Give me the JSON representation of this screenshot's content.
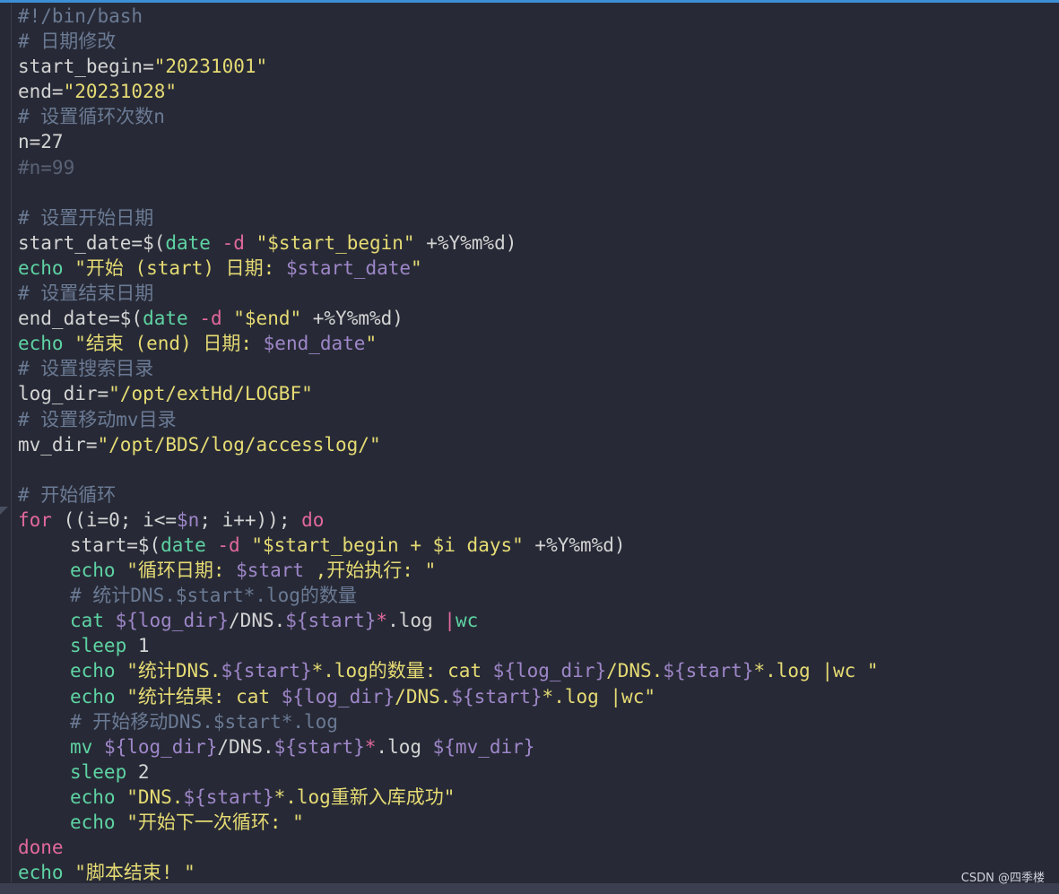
{
  "editor": {
    "lines": [
      {
        "indent": false,
        "tokens": [
          {
            "t": "#!/bin/bash",
            "c": "c-comment"
          }
        ]
      },
      {
        "indent": false,
        "tokens": [
          {
            "t": "# 日期修改",
            "c": "c-comment"
          }
        ]
      },
      {
        "indent": false,
        "tokens": [
          {
            "t": "start_begin=",
            "c": "c-var"
          },
          {
            "t": "\"20231001\"",
            "c": "c-str"
          }
        ]
      },
      {
        "indent": false,
        "tokens": [
          {
            "t": "end=",
            "c": "c-var"
          },
          {
            "t": "\"20231028\"",
            "c": "c-str"
          }
        ]
      },
      {
        "indent": false,
        "tokens": [
          {
            "t": "# 设置循环次数n",
            "c": "c-comment"
          }
        ]
      },
      {
        "indent": false,
        "tokens": [
          {
            "t": "n=27",
            "c": "c-var"
          }
        ]
      },
      {
        "indent": false,
        "tokens": [
          {
            "t": "#n=99",
            "c": "c-comment-dim"
          }
        ]
      },
      {
        "indent": false,
        "tokens": [
          {
            "t": "",
            "c": "c-var"
          }
        ]
      },
      {
        "indent": false,
        "tokens": [
          {
            "t": "# 设置开始日期",
            "c": "c-comment"
          }
        ]
      },
      {
        "indent": false,
        "tokens": [
          {
            "t": "start_date=$(",
            "c": "c-var"
          },
          {
            "t": "date",
            "c": "c-cmd"
          },
          {
            "t": " ",
            "c": "c-var"
          },
          {
            "t": "-d",
            "c": "c-flag"
          },
          {
            "t": " ",
            "c": "c-var"
          },
          {
            "t": "\"$start_begin\"",
            "c": "c-str"
          },
          {
            "t": " +%Y%m%d)",
            "c": "c-var"
          }
        ]
      },
      {
        "indent": false,
        "tokens": [
          {
            "t": "echo",
            "c": "c-cmd"
          },
          {
            "t": " \"开始 (start) 日期: ",
            "c": "c-str"
          },
          {
            "t": "$start_date",
            "c": "c-sub"
          },
          {
            "t": "\"",
            "c": "c-str"
          }
        ]
      },
      {
        "indent": false,
        "tokens": [
          {
            "t": "# 设置结束日期",
            "c": "c-comment"
          }
        ]
      },
      {
        "indent": false,
        "tokens": [
          {
            "t": "end_date=$(",
            "c": "c-var"
          },
          {
            "t": "date",
            "c": "c-cmd"
          },
          {
            "t": " ",
            "c": "c-var"
          },
          {
            "t": "-d",
            "c": "c-flag"
          },
          {
            "t": " ",
            "c": "c-var"
          },
          {
            "t": "\"$end\"",
            "c": "c-str"
          },
          {
            "t": " +%Y%m%d)",
            "c": "c-var"
          }
        ]
      },
      {
        "indent": false,
        "tokens": [
          {
            "t": "echo",
            "c": "c-cmd"
          },
          {
            "t": " \"结束 (end) 日期: ",
            "c": "c-str"
          },
          {
            "t": "$end_date",
            "c": "c-sub"
          },
          {
            "t": "\"",
            "c": "c-str"
          }
        ]
      },
      {
        "indent": false,
        "tokens": [
          {
            "t": "# 设置搜索目录",
            "c": "c-comment"
          }
        ]
      },
      {
        "indent": false,
        "tokens": [
          {
            "t": "log_dir=",
            "c": "c-var"
          },
          {
            "t": "\"/opt/extHd/LOGBF\"",
            "c": "c-str"
          }
        ]
      },
      {
        "indent": false,
        "tokens": [
          {
            "t": "# 设置移动mv目录",
            "c": "c-comment"
          }
        ]
      },
      {
        "indent": false,
        "tokens": [
          {
            "t": "mv_dir=",
            "c": "c-var"
          },
          {
            "t": "\"/opt/BDS/log/accesslog/\"",
            "c": "c-str"
          }
        ]
      },
      {
        "indent": false,
        "tokens": [
          {
            "t": "",
            "c": "c-var"
          }
        ]
      },
      {
        "indent": false,
        "tokens": [
          {
            "t": "# 开始循环",
            "c": "c-comment"
          }
        ]
      },
      {
        "indent": false,
        "tokens": [
          {
            "t": "for",
            "c": "c-kw"
          },
          {
            "t": " ((i=0; i<=",
            "c": "c-var"
          },
          {
            "t": "$n",
            "c": "c-sub"
          },
          {
            "t": "; i++)); ",
            "c": "c-var"
          },
          {
            "t": "do",
            "c": "c-kw"
          }
        ]
      },
      {
        "indent": true,
        "tokens": [
          {
            "t": "start=$(",
            "c": "c-var"
          },
          {
            "t": "date",
            "c": "c-cmd"
          },
          {
            "t": " ",
            "c": "c-var"
          },
          {
            "t": "-d",
            "c": "c-flag"
          },
          {
            "t": " ",
            "c": "c-var"
          },
          {
            "t": "\"$start_begin + $i days\"",
            "c": "c-str"
          },
          {
            "t": " +%Y%m%d)",
            "c": "c-var"
          }
        ]
      },
      {
        "indent": true,
        "tokens": [
          {
            "t": "echo",
            "c": "c-cmd"
          },
          {
            "t": " \"循环日期: ",
            "c": "c-str"
          },
          {
            "t": "$start",
            "c": "c-sub"
          },
          {
            "t": " ,开始执行: \"",
            "c": "c-str"
          }
        ]
      },
      {
        "indent": true,
        "tokens": [
          {
            "t": "# 统计DNS.$start*.log的数量",
            "c": "c-comment"
          }
        ]
      },
      {
        "indent": true,
        "tokens": [
          {
            "t": "cat",
            "c": "c-cmd"
          },
          {
            "t": " ",
            "c": "c-var"
          },
          {
            "t": "${log_dir}",
            "c": "c-sub"
          },
          {
            "t": "/DNS.",
            "c": "c-var"
          },
          {
            "t": "${start}",
            "c": "c-sub"
          },
          {
            "t": "*",
            "c": "c-flag"
          },
          {
            "t": ".log ",
            "c": "c-var"
          },
          {
            "t": "|",
            "c": "c-flag"
          },
          {
            "t": "wc",
            "c": "c-cmd"
          }
        ]
      },
      {
        "indent": true,
        "tokens": [
          {
            "t": "sleep",
            "c": "c-cmd"
          },
          {
            "t": " 1",
            "c": "c-var"
          }
        ]
      },
      {
        "indent": true,
        "tokens": [
          {
            "t": "echo",
            "c": "c-cmd"
          },
          {
            "t": " \"统计DNS.",
            "c": "c-str"
          },
          {
            "t": "${start}",
            "c": "c-sub"
          },
          {
            "t": "*.log的数量: cat ",
            "c": "c-str"
          },
          {
            "t": "${log_dir}",
            "c": "c-sub"
          },
          {
            "t": "/DNS.",
            "c": "c-str"
          },
          {
            "t": "${start}",
            "c": "c-sub"
          },
          {
            "t": "*.log |wc \"",
            "c": "c-str"
          }
        ]
      },
      {
        "indent": true,
        "tokens": [
          {
            "t": "echo",
            "c": "c-cmd"
          },
          {
            "t": " \"统计结果: cat ",
            "c": "c-str"
          },
          {
            "t": "${log_dir}",
            "c": "c-sub"
          },
          {
            "t": "/DNS.",
            "c": "c-str"
          },
          {
            "t": "${start}",
            "c": "c-sub"
          },
          {
            "t": "*.log |wc\"",
            "c": "c-str"
          }
        ]
      },
      {
        "indent": true,
        "tokens": [
          {
            "t": "# 开始移动DNS.$start*.log",
            "c": "c-comment"
          }
        ]
      },
      {
        "indent": true,
        "tokens": [
          {
            "t": "mv",
            "c": "c-cmd"
          },
          {
            "t": " ",
            "c": "c-var"
          },
          {
            "t": "${log_dir}",
            "c": "c-sub"
          },
          {
            "t": "/DNS.",
            "c": "c-var"
          },
          {
            "t": "${start}",
            "c": "c-sub"
          },
          {
            "t": "*",
            "c": "c-flag"
          },
          {
            "t": ".log ",
            "c": "c-var"
          },
          {
            "t": "${mv_dir}",
            "c": "c-sub"
          }
        ]
      },
      {
        "indent": true,
        "tokens": [
          {
            "t": "sleep",
            "c": "c-cmd"
          },
          {
            "t": " 2",
            "c": "c-var"
          }
        ]
      },
      {
        "indent": true,
        "tokens": [
          {
            "t": "echo",
            "c": "c-cmd"
          },
          {
            "t": " \"DNS.",
            "c": "c-str"
          },
          {
            "t": "${start}",
            "c": "c-sub"
          },
          {
            "t": "*.log重新入库成功\"",
            "c": "c-str"
          }
        ]
      },
      {
        "indent": true,
        "tokens": [
          {
            "t": "echo",
            "c": "c-cmd"
          },
          {
            "t": " \"开始下一次循环: \"",
            "c": "c-str"
          }
        ]
      },
      {
        "indent": false,
        "tokens": [
          {
            "t": "done",
            "c": "c-kw"
          }
        ]
      },
      {
        "indent": false,
        "tokens": [
          {
            "t": "echo",
            "c": "c-cmd"
          },
          {
            "t": " \"脚本结束! \"",
            "c": "c-str"
          }
        ]
      }
    ]
  },
  "watermark": "CSDN @四季楼",
  "colors": {
    "background": "#272a36",
    "accent_border": "#3d8fd6",
    "comment": "#6b7a94",
    "string": "#e6db74",
    "keyword": "#e2689c",
    "command": "#5ed3a3",
    "variable_expansion": "#9e86c8"
  }
}
